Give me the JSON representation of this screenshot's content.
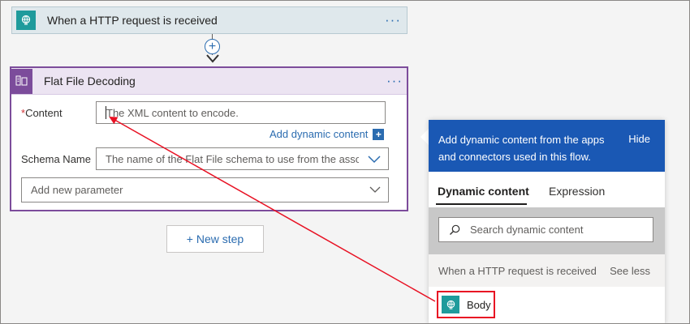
{
  "trigger": {
    "title": "When a HTTP request is received",
    "more": "···",
    "icon": "globe-icon"
  },
  "connector": {
    "plus": "+"
  },
  "action": {
    "title": "Flat File Decoding",
    "more": "···",
    "icon": "flat-file-icon",
    "content_required": "*",
    "content_label": "Content",
    "content_placeholder": "The XML content to encode.",
    "add_dynamic_content": "Add dynamic content",
    "add_dynamic_content_icon": "+",
    "schema_label": "Schema Name",
    "schema_placeholder": "The name of the Flat File schema to use from the associated integration account",
    "add_parameter": "Add new parameter"
  },
  "new_step": {
    "label": "+ New step"
  },
  "dynamic_panel": {
    "header_text": "Add dynamic content from the apps and connectors used in this flow.",
    "hide_label": "Hide",
    "tabs": [
      {
        "label": "Dynamic content",
        "active": true
      },
      {
        "label": "Expression",
        "active": false
      }
    ],
    "search_placeholder": "Search dynamic content",
    "section_title": "When a HTTP request is received",
    "see_less": "See less",
    "token_label": "Body"
  },
  "colors": {
    "accent": "#2b6cb0",
    "trigger_teal": "#1f9b9c",
    "action_purple": "#7c4c9b",
    "panel_header": "#1a58b4",
    "highlight_red": "#e81123"
  }
}
